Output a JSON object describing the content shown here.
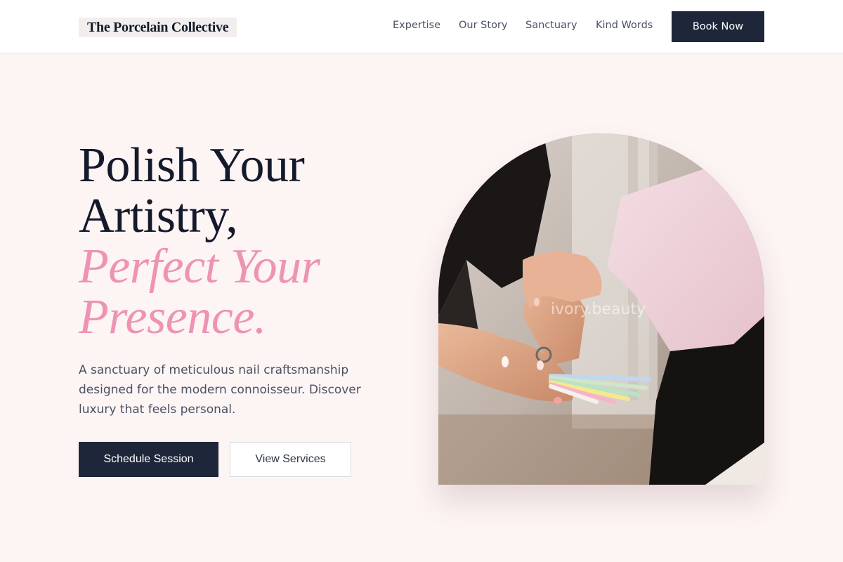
{
  "header": {
    "brand": "The Porcelain Collective",
    "nav": [
      {
        "label": "Expertise"
      },
      {
        "label": "Our Story"
      },
      {
        "label": "Sanctuary"
      },
      {
        "label": "Kind Words"
      }
    ],
    "cta_label": "Book Now"
  },
  "hero": {
    "heading_lines": [
      "Polish Your",
      "Artistry,"
    ],
    "heading_accent_lines": [
      "Perfect Your",
      "Presence."
    ],
    "subtitle": "A sanctuary of meticulous nail craftsmanship designed for the modern connoisseur. Discover luxury that feels personal.",
    "primary_button": "Schedule Session",
    "secondary_button": "View Services",
    "image": {
      "watermark": "ivory.beauty"
    }
  },
  "colors": {
    "background": "#fdf4f4",
    "navy": "#1e2739",
    "accent_pink": "#ee93b3",
    "body_text": "#4a5262"
  }
}
